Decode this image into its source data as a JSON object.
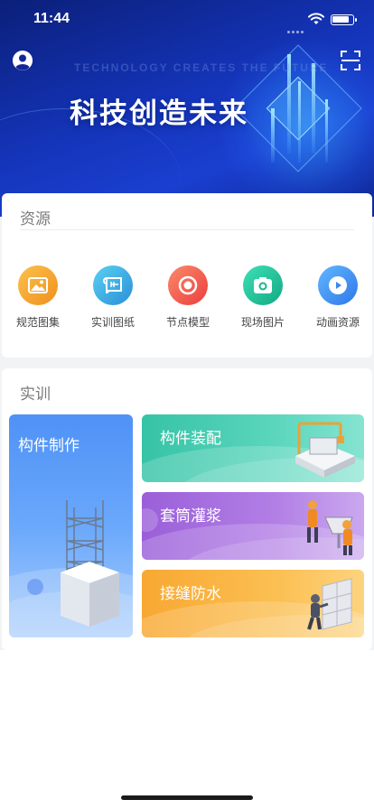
{
  "status_bar": {
    "time": "11:44",
    "battery_level": 0.85
  },
  "hero": {
    "title": "科技创造未来",
    "ghost_text": "TECHNOLOGY CREATES THE FUTURE"
  },
  "resources": {
    "title": "资源",
    "items": [
      {
        "label": "规范图集",
        "icon": "image-gallery-icon",
        "color": "#f7a325"
      },
      {
        "label": "实训图纸",
        "icon": "blueprint-icon",
        "color": "#3fb6e0"
      },
      {
        "label": "节点模型",
        "icon": "node-model-icon",
        "color": "#f25c4a"
      },
      {
        "label": "现场图片",
        "icon": "camera-icon",
        "color": "#1fbf96"
      },
      {
        "label": "动画资源",
        "icon": "play-icon",
        "color": "#3d8ff2"
      }
    ]
  },
  "training": {
    "title": "实训",
    "tiles": [
      {
        "label": "构件制作",
        "icon": "tower-illustration",
        "color": "#4f92f6"
      },
      {
        "label": "构件装配",
        "icon": "assembly-illustration",
        "color": "#36c3a6"
      },
      {
        "label": "套筒灌浆",
        "icon": "grouting-worker-illustration",
        "color": "#9b5fd9"
      },
      {
        "label": "接缝防水",
        "icon": "waterproofing-worker-illustration",
        "color": "#f8a832"
      }
    ]
  }
}
